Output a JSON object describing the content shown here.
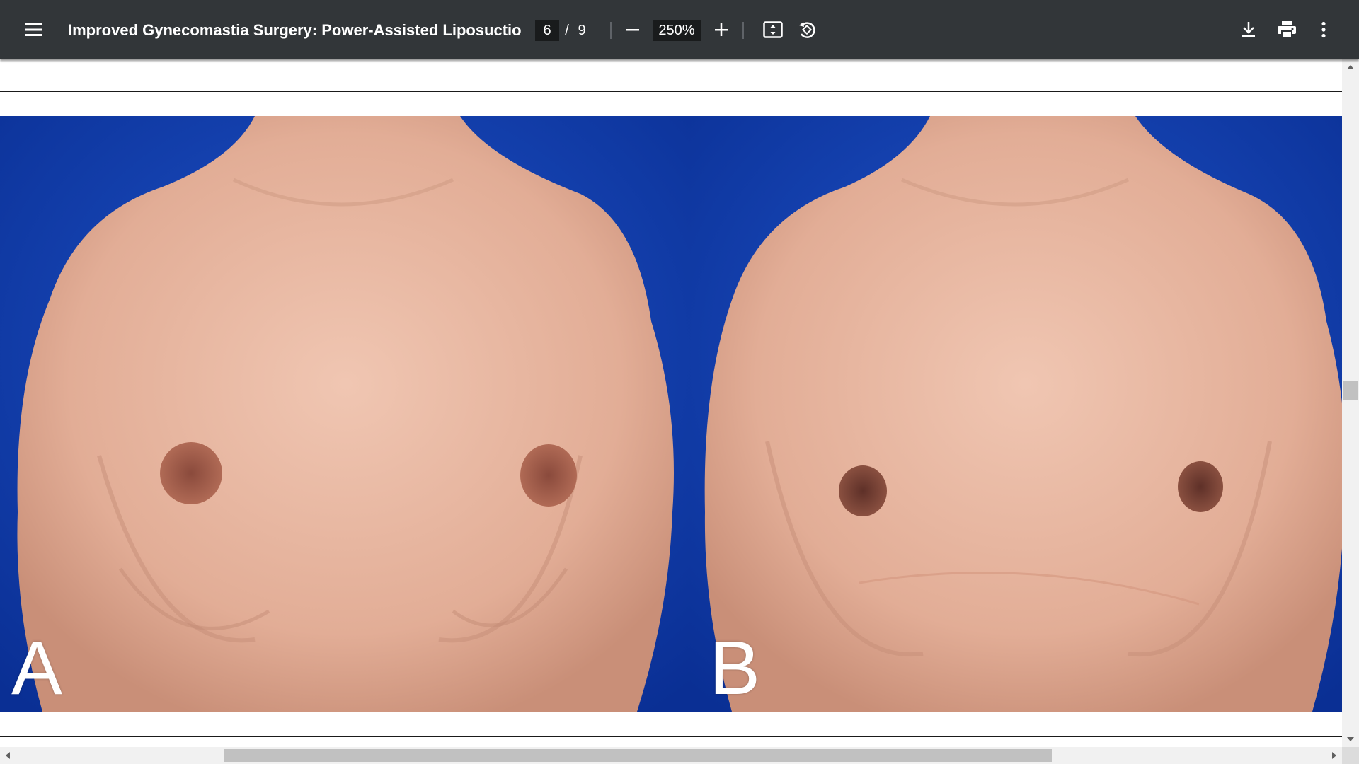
{
  "toolbar": {
    "menu_icon": "hamburger-menu-icon",
    "title": "Improved Gynecomastia Surgery: Power-Assisted Liposuction Wi...",
    "page_current": "6",
    "page_separator": "/",
    "page_total": "9",
    "zoom_out_icon": "minus-icon",
    "zoom_value": "250%",
    "zoom_in_icon": "plus-icon",
    "fit_icon": "fit-to-page-icon",
    "rotate_icon": "rotate-counterclockwise-icon",
    "download_icon": "download-icon",
    "print_icon": "print-icon",
    "more_icon": "more-vert-icon"
  },
  "document": {
    "figure": {
      "panel_a_label": "A",
      "panel_b_label": "B"
    }
  },
  "scrollbars": {
    "vertical_position": 0.48,
    "horizontal_visible_fraction": 0.63,
    "horizontal_position": 0.16
  },
  "colors": {
    "toolbar_bg": "#323639",
    "photo_background": "#0b3aa8",
    "skin": "#e6b6a0"
  }
}
